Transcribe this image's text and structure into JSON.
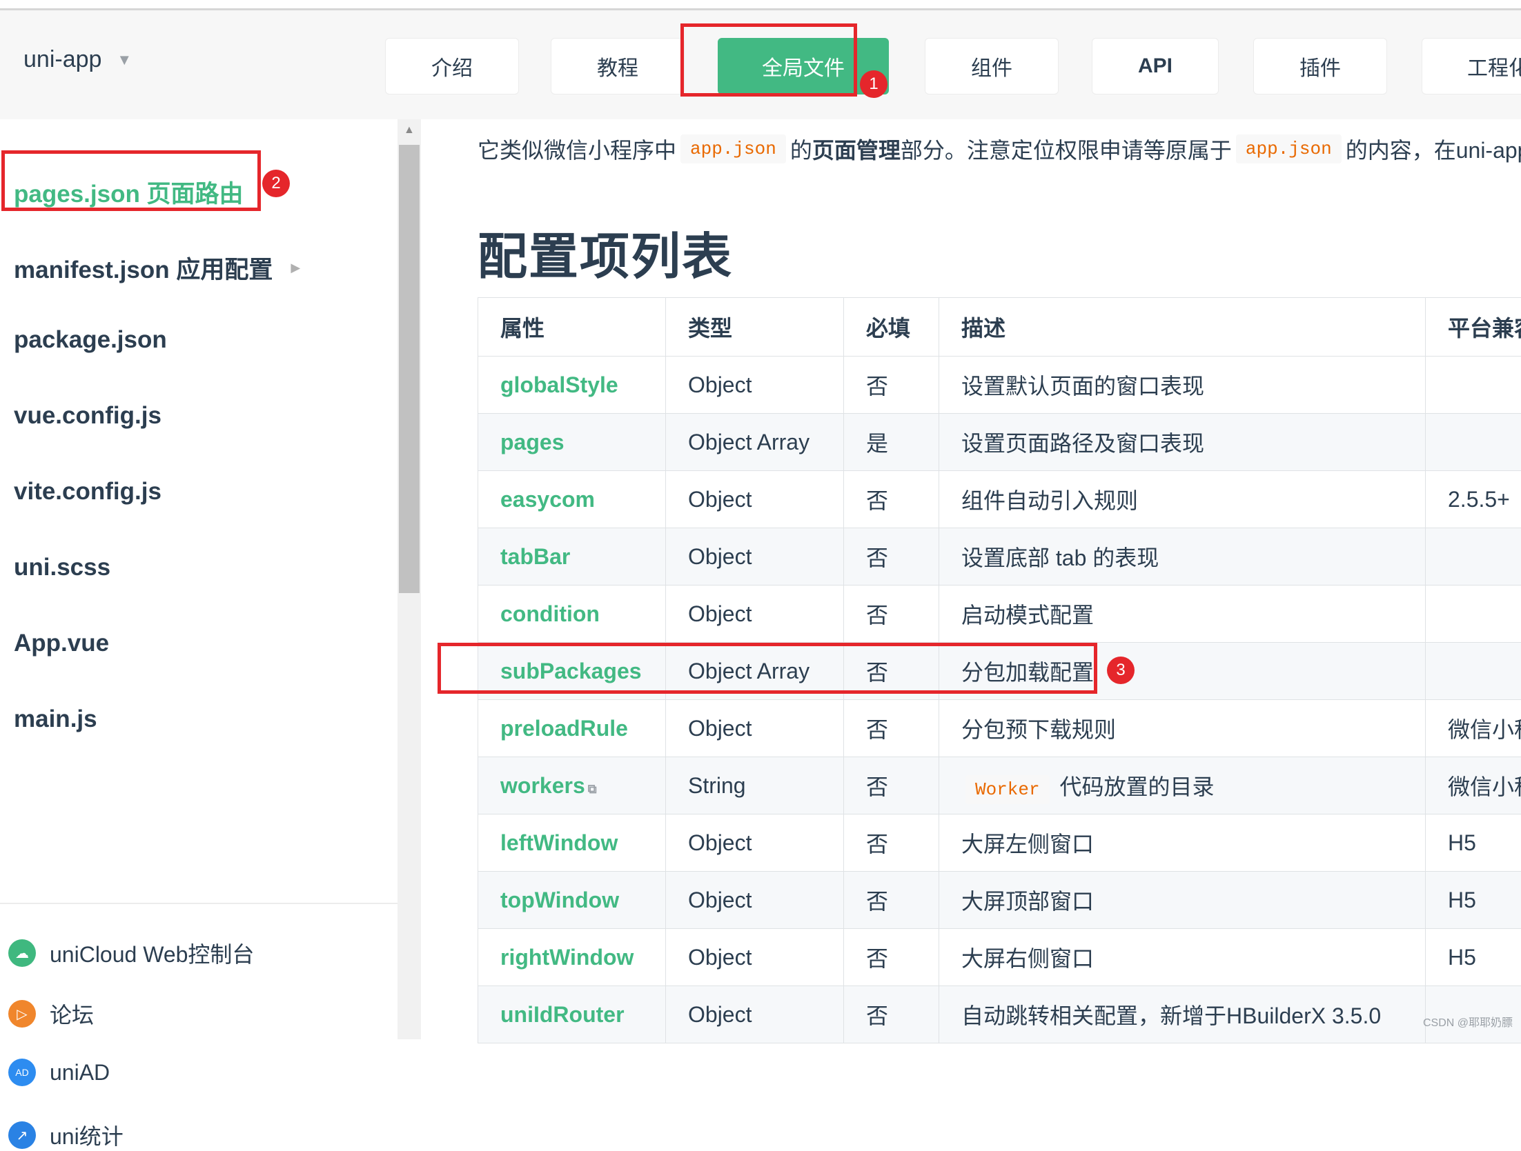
{
  "header": {
    "brand": "uni-app",
    "nav": [
      {
        "label": "介绍"
      },
      {
        "label": "教程"
      },
      {
        "label": "全局文件",
        "active": true
      },
      {
        "label": "组件"
      },
      {
        "label": "API"
      },
      {
        "label": "插件"
      },
      {
        "label": "工程化"
      }
    ]
  },
  "annotations": [
    "1",
    "2",
    "3"
  ],
  "sidebar": {
    "items": [
      {
        "label": "pages.json 页面路由",
        "active": true
      },
      {
        "label": "manifest.json 应用配置",
        "has_children": true
      },
      {
        "label": "package.json"
      },
      {
        "label": "vue.config.js"
      },
      {
        "label": "vite.config.js"
      },
      {
        "label": "uni.scss"
      },
      {
        "label": "App.vue"
      },
      {
        "label": "main.js"
      }
    ],
    "links": [
      {
        "label": "uniCloud Web控制台",
        "icon": "cloud-icon",
        "color": "#3fb87f"
      },
      {
        "label": "论坛",
        "icon": "forum-icon",
        "color": "#f0862c"
      },
      {
        "label": "uniAD",
        "icon": "ad-icon",
        "color": "#2d8cf0"
      },
      {
        "label": "uni统计",
        "icon": "stats-icon",
        "color": "#2a82e4"
      }
    ]
  },
  "content": {
    "intro": {
      "p1": "它类似微信小程序中",
      "code1": "app.json",
      "p2": "的",
      "bold": "页面管理",
      "p3": "部分。注意定位权限申请等原属于",
      "code2": "app.json",
      "p4": "的内容，在uni-app中"
    },
    "section_title": "配置项列表",
    "table": {
      "headers": [
        "属性",
        "类型",
        "必填",
        "描述",
        "平台兼容"
      ],
      "rows": [
        {
          "attr": "globalStyle",
          "type": "Object",
          "required": "否",
          "desc": "设置默认页面的窗口表现",
          "platform": ""
        },
        {
          "attr": "pages",
          "type": "Object Array",
          "required": "是",
          "desc": "设置页面路径及窗口表现",
          "platform": ""
        },
        {
          "attr": "easycom",
          "type": "Object",
          "required": "否",
          "desc": "组件自动引入规则",
          "platform": "2.5.5+"
        },
        {
          "attr": "tabBar",
          "type": "Object",
          "required": "否",
          "desc": "设置底部 tab 的表现",
          "platform": ""
        },
        {
          "attr": "condition",
          "type": "Object",
          "required": "否",
          "desc": "启动模式配置",
          "platform": ""
        },
        {
          "attr": "subPackages",
          "type": "Object Array",
          "required": "否",
          "desc": "分包加载配置",
          "platform": ""
        },
        {
          "attr": "preloadRule",
          "type": "Object",
          "required": "否",
          "desc": "分包预下载规则",
          "platform": "微信小程序"
        },
        {
          "attr": "workers",
          "type": "String",
          "required": "否",
          "desc_code": "Worker",
          "desc": "代码放置的目录",
          "platform": "微信小程序",
          "external_link": true
        },
        {
          "attr": "leftWindow",
          "type": "Object",
          "required": "否",
          "desc": "大屏左侧窗口",
          "platform": "H5"
        },
        {
          "attr": "topWindow",
          "type": "Object",
          "required": "否",
          "desc": "大屏顶部窗口",
          "platform": "H5"
        },
        {
          "attr": "rightWindow",
          "type": "Object",
          "required": "否",
          "desc": "大屏右侧窗口",
          "platform": "H5"
        },
        {
          "attr": "uniIdRouter",
          "type": "Object",
          "required": "否",
          "desc": "自动跳转相关配置，新增于HBuilderX 3.5.0",
          "platform": ""
        }
      ]
    }
  },
  "watermark": "CSDN @耶耶奶膘"
}
